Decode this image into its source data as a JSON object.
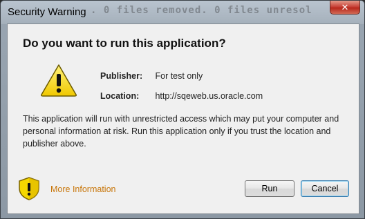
{
  "window": {
    "title": "Security Warning",
    "background_text": ". 0 files removed. 0 files unresol",
    "close_glyph": "✕"
  },
  "dialog": {
    "headline": "Do you want to run this application?",
    "publisher_label": "Publisher:",
    "publisher_value": "For test only",
    "location_label": "Location:",
    "location_value": "http://sqeweb.us.oracle.com",
    "message": "This application will run with unrestricted access which may put your computer and personal information at risk. Run this application only if you trust the location and publisher above.",
    "more_info_label": "More Information",
    "run_label": "Run",
    "cancel_label": "Cancel",
    "icons": {
      "warning": "warning-triangle-icon",
      "shield": "shield-icon"
    },
    "colors": {
      "link": "#c8760a",
      "warning_yellow": "#f5d800",
      "close_red": "#c9443a"
    }
  }
}
